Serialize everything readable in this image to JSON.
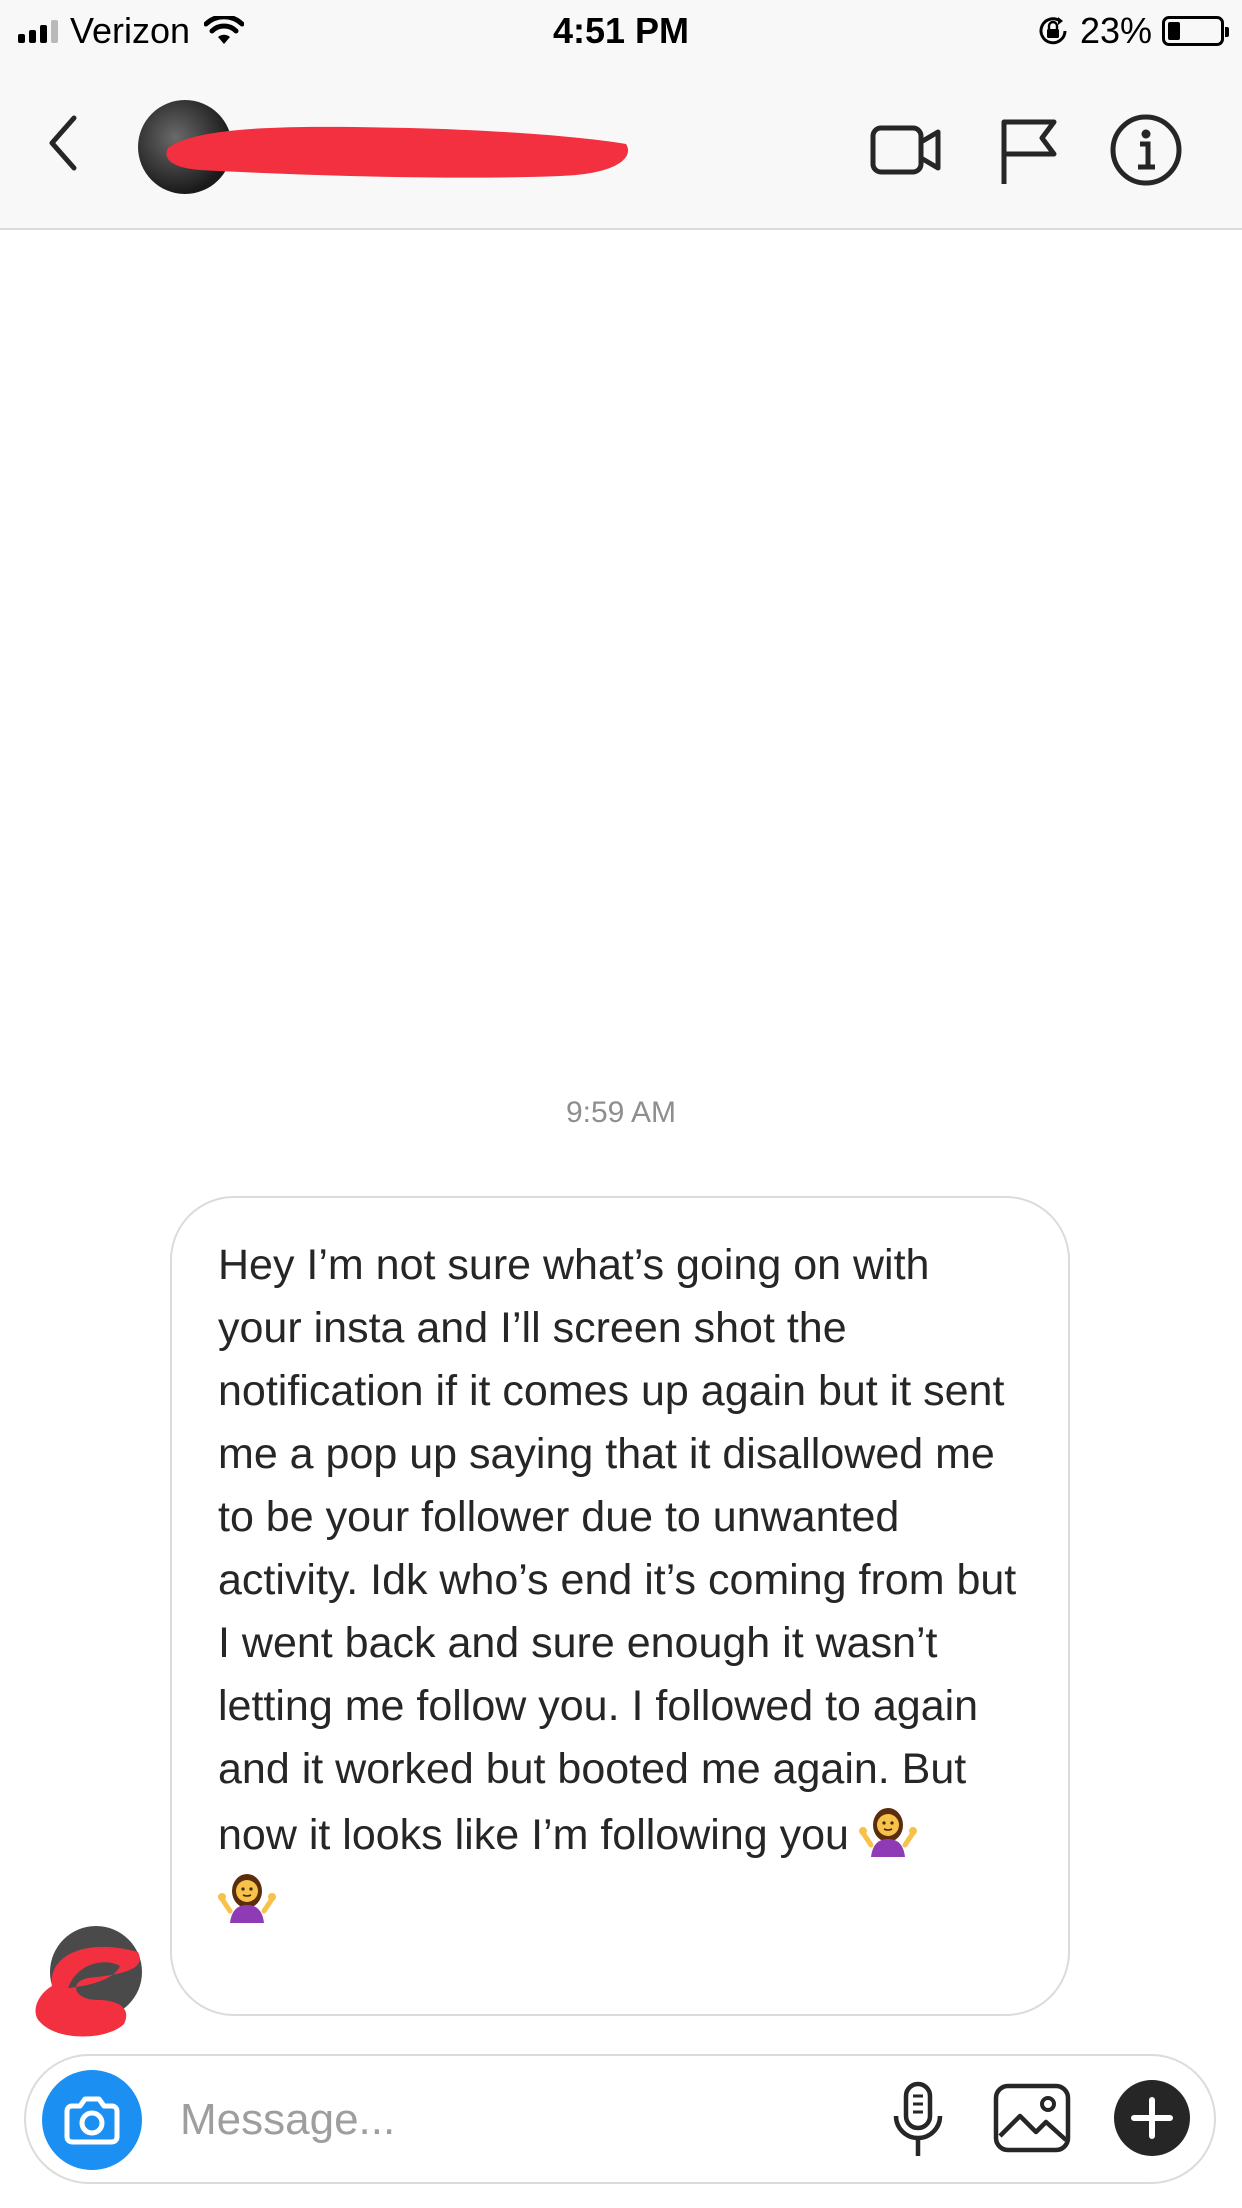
{
  "status_bar": {
    "carrier": "Verizon",
    "time": "4:51 PM",
    "battery_percent": "23%",
    "battery_level": 0.23,
    "signal_bars_active": 3,
    "icons": [
      "signal-icon",
      "wifi-icon",
      "rotation-lock-icon",
      "battery-icon"
    ]
  },
  "header": {
    "icons": [
      "back-chevron-icon",
      "video-call-icon",
      "flag-icon",
      "info-icon"
    ],
    "username_redacted": true
  },
  "conversation": {
    "timestamp": "9:59 AM",
    "message": {
      "text": "Hey I’m not sure what’s going on with your insta and I’ll screen shot the notification if it comes up again but it sent me a pop up saying that it disallowed me to be your follower due to unwanted activity. Idk who’s end it’s coming from but I went back and sure enough it wasn’t letting me follow you. I followed to again and it worked but booted me again. But now it looks like I’m following you",
      "emoji": [
        "woman-shrugging-emoji",
        "woman-shrugging-emoji"
      ]
    }
  },
  "composer": {
    "placeholder": "Message...",
    "icons": [
      "camera-icon",
      "microphone-icon",
      "gallery-icon",
      "plus-icon"
    ]
  },
  "colors": {
    "camera_button": "#1c8ff2",
    "redaction": "#f2303f",
    "bubble_border": "#dbdbdb",
    "timestamp": "#8e8e8e"
  }
}
